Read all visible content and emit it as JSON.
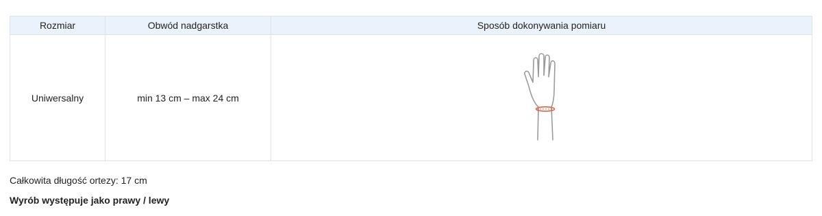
{
  "table": {
    "headers": [
      "Rozmiar",
      "Obwód nadgarstka",
      "Sposób dokonywania pomiaru"
    ],
    "rows": [
      {
        "size": "Uniwersalny",
        "circumference": "min 13 cm – max 24 cm"
      }
    ]
  },
  "notes": {
    "length": "Całkowita długość ortezy: 17 cm",
    "side": "Wyrób występuje jako prawy / lewy"
  },
  "icons": {
    "measurement_illustration": "wrist-measurement-icon"
  },
  "colors": {
    "header_bg": "#eaf3fb",
    "border": "#dfe3e8",
    "hand_outline": "#9a9a9a",
    "measure_band": "#e0604a"
  }
}
